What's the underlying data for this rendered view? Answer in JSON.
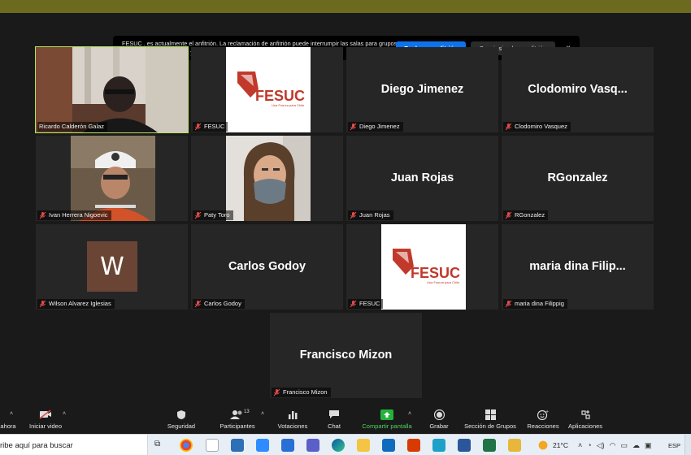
{
  "banner": {
    "text": "FESUC . es actualmente el anfitrión. La reclamación de anfitrión puede interrumpir las salas para grupos pequeños, las votaciones y la pantalla compartida",
    "claim_label": "Reclamar anfitrión",
    "stay_label": "Seguir siendo coanfitrión",
    "close_glyph": "×"
  },
  "participants": [
    {
      "name": "Ricardo Calderón Galaz",
      "kind": "video",
      "active": true
    },
    {
      "name": "FESUC",
      "kind": "logo"
    },
    {
      "name": "Diego Jimenez",
      "kind": "text",
      "display": "Diego Jimenez"
    },
    {
      "name": "Clodomiro Vasquez",
      "kind": "text",
      "display": "Clodomiro  Vasq..."
    },
    {
      "name": "Ivan Herrera Nigoevic",
      "kind": "video"
    },
    {
      "name": "Paty Toro",
      "kind": "video"
    },
    {
      "name": "Juan Rojas",
      "kind": "text",
      "display": "Juan Rojas"
    },
    {
      "name": "RGonzalez",
      "kind": "text",
      "display": "RGonzalez"
    },
    {
      "name": "Wilson Alvarez Iglesias",
      "kind": "avatar",
      "initial": "W"
    },
    {
      "name": "Carlos Godoy",
      "kind": "text",
      "display": "Carlos Godoy"
    },
    {
      "name": "FESUC",
      "kind": "logo"
    },
    {
      "name": "maria dina Filippig",
      "kind": "text",
      "display": "maria dina  Filip..."
    },
    {
      "name": "Francisco Mizon",
      "kind": "text",
      "display": "Francisco Mizon"
    }
  ],
  "logo": {
    "brand": "FESUC",
    "tagline": "Una Fuerza para Chile"
  },
  "toolbar": {
    "ahora": "ahora",
    "video": "Iniciar video",
    "security": "Seguridad",
    "participants": "Participantes",
    "participants_count": "13",
    "votes": "Votaciones",
    "chat": "Chat",
    "share": "Compartir pantalla",
    "record": "Grabar",
    "groups": "Sección de Grupos",
    "reactions": "Reacciones",
    "apps": "Aplicaciones"
  },
  "taskbar": {
    "search_placeholder": "ribe aquí para buscar",
    "temperature": "21°C",
    "language": "ESP"
  },
  "colors": {
    "zoom_blue": "#0e72ed",
    "active_speaker": "#b7e35b",
    "share_green": "#4fd35b",
    "mute_red": "#e24a4a"
  }
}
